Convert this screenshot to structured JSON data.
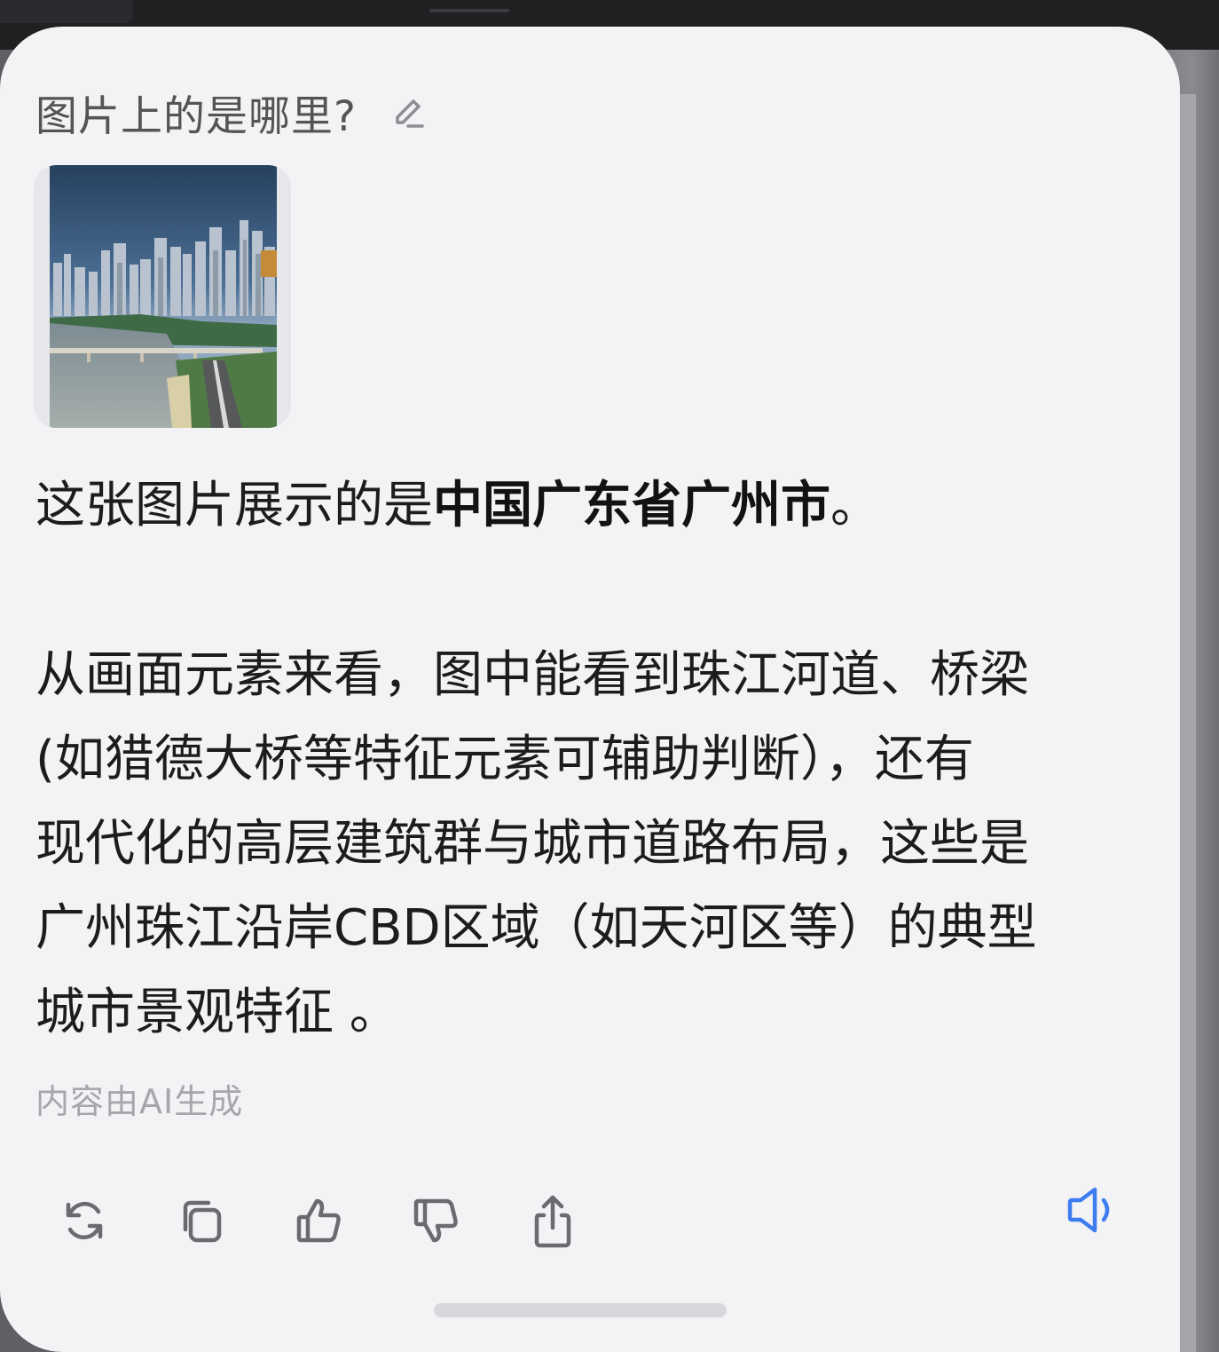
{
  "question": {
    "text": "图片上的是哪里?",
    "edit_icon": "pencil-icon"
  },
  "image": {
    "description_icon": "city-skyline-thumbnail"
  },
  "answer": {
    "line1_prefix": "这张图片展示的是",
    "line1_bold": "中国广东省广州市",
    "line1_suffix": "。",
    "paragraph2": [
      "从画面元素来看，图中能看到珠江河道、桥梁",
      "(如猎德大桥等特征元素可辅助判断），还有",
      "现代化的高层建筑群与城市道路布局，这些是",
      "广州珠江沿岸CBD区域（如天河区等）的典型",
      "城市景观特征 。"
    ]
  },
  "disclaimer": "内容由AI生成",
  "actions": [
    {
      "name": "regenerate-button",
      "icon": "refresh-icon"
    },
    {
      "name": "copy-button",
      "icon": "copy-icon"
    },
    {
      "name": "like-button",
      "icon": "thumbs-up-icon"
    },
    {
      "name": "dislike-button",
      "icon": "thumbs-down-icon"
    },
    {
      "name": "share-button",
      "icon": "share-icon"
    },
    {
      "name": "speak-button",
      "icon": "speaker-icon"
    }
  ],
  "colors": {
    "card_bg": "#f3f3f5",
    "text": "#1c1c1e",
    "muted": "#a7a7ab",
    "icon": "#6b6b6f",
    "accent": "#3d7df0"
  }
}
